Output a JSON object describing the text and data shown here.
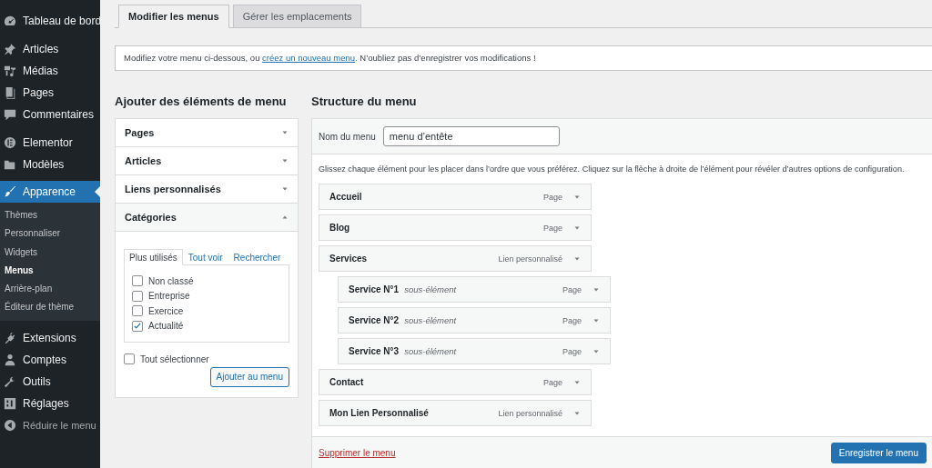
{
  "sidebar": {
    "items": [
      {
        "label": "Tableau de bord",
        "selected": false
      },
      {
        "label": "Articles",
        "selected": false
      },
      {
        "label": "Médias",
        "selected": false
      },
      {
        "label": "Pages",
        "selected": false
      },
      {
        "label": "Commentaires",
        "selected": false
      },
      {
        "label": "Elementor",
        "selected": false
      },
      {
        "label": "Modèles",
        "selected": false
      },
      {
        "label": "Apparence",
        "selected": true,
        "children": [
          {
            "label": "Thèmes",
            "selected": false
          },
          {
            "label": "Personnaliser",
            "selected": false
          },
          {
            "label": "Widgets",
            "selected": false
          },
          {
            "label": "Menus",
            "selected": true
          },
          {
            "label": "Arrière-plan",
            "selected": false
          },
          {
            "label": "Éditeur de thème",
            "selected": false
          }
        ]
      },
      {
        "label": "Extensions",
        "selected": false
      },
      {
        "label": "Comptes",
        "selected": false
      },
      {
        "label": "Outils",
        "selected": false
      },
      {
        "label": "Réglages",
        "selected": false
      }
    ],
    "collapse": "Réduire le menu"
  },
  "tabs": [
    {
      "label": "Modifier les menus",
      "selected": true
    },
    {
      "label": "Gérer les emplacements",
      "selected": false
    }
  ],
  "notice": {
    "before": "Modifiez votre menu ci-dessous, ou ",
    "link": "créez un nouveau menu",
    "after": ". N’oubliez pas d’enregistrer vos modifications !"
  },
  "add_items": {
    "heading": "Ajouter des éléments de menu",
    "sections": [
      {
        "label": "Pages",
        "expanded": false
      },
      {
        "label": "Articles",
        "expanded": false
      },
      {
        "label": "Liens personnalisés",
        "expanded": false
      },
      {
        "label": "Catégories",
        "expanded": true
      }
    ],
    "category_tabs": [
      {
        "label": "Plus utilisés",
        "selected": true
      },
      {
        "label": "Tout voir",
        "selected": false
      },
      {
        "label": "Rechercher",
        "selected": false
      }
    ],
    "categories": [
      {
        "label": "Non classé",
        "checked": false
      },
      {
        "label": "Entreprise",
        "checked": false
      },
      {
        "label": "Exercice",
        "checked": false
      },
      {
        "label": "Actualité",
        "checked": true
      }
    ],
    "select_all": {
      "label": "Tout sélectionner",
      "checked": false
    },
    "button": "Ajouter au menu"
  },
  "structure": {
    "heading": "Structure du menu",
    "name_label": "Nom du menu",
    "name_value": "menu d’entête",
    "instructions": "Glissez chaque élément pour les placer dans l’ordre que vous préférez. Cliquez sur la flèche à droite de l’élément pour révéler d’autres options de configuration.",
    "items": [
      {
        "title": "Accueil",
        "type": "Page"
      },
      {
        "title": "Blog",
        "type": "Page"
      },
      {
        "title": "Services",
        "type": "Lien personnalisé",
        "children": [
          {
            "title": "Service N°1",
            "subtitle": "sous-élément",
            "type": "Page"
          },
          {
            "title": "Service N°2",
            "subtitle": "sous-élément",
            "type": "Page"
          },
          {
            "title": "Service N°3",
            "subtitle": "sous-élément",
            "type": "Page"
          }
        ]
      },
      {
        "title": "Contact",
        "type": "Page"
      },
      {
        "title": "Mon Lien Personnalisé",
        "type": "Lien personnalisé"
      }
    ],
    "delete_link": "Supprimer le menu",
    "save_button": "Enregistrer le menu"
  }
}
